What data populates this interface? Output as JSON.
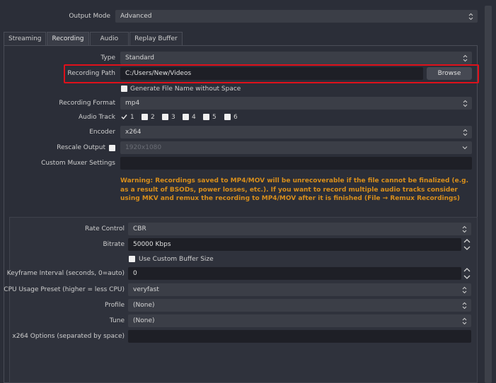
{
  "output_mode": {
    "label": "Output Mode",
    "value": "Advanced"
  },
  "tabs": [
    {
      "label": "Streaming",
      "active": false
    },
    {
      "label": "Recording",
      "active": true
    },
    {
      "label": "Audio",
      "active": false
    },
    {
      "label": "Replay Buffer",
      "active": false
    }
  ],
  "recording": {
    "type": {
      "label": "Type",
      "value": "Standard"
    },
    "path": {
      "label": "Recording Path",
      "value": "C:/Users/New/Videos",
      "browse_label": "Browse"
    },
    "generate_filename": {
      "label": "Generate File Name without Space",
      "checked": false
    },
    "format": {
      "label": "Recording Format",
      "value": "mp4"
    },
    "audio_track": {
      "label": "Audio Track",
      "tracks": [
        {
          "label": "1",
          "checked": true
        },
        {
          "label": "2",
          "checked": false
        },
        {
          "label": "3",
          "checked": false
        },
        {
          "label": "4",
          "checked": false
        },
        {
          "label": "5",
          "checked": false
        },
        {
          "label": "6",
          "checked": false
        }
      ]
    },
    "encoder": {
      "label": "Encoder",
      "value": "x264"
    },
    "rescale": {
      "label": "Rescale Output",
      "checked": false,
      "value": "1920x1080"
    },
    "custom_muxer": {
      "label": "Custom Muxer Settings",
      "value": ""
    },
    "warning": "Warning: Recordings saved to MP4/MOV will be unrecoverable if the file cannot be finalized (e.g. as a result of BSODs, power losses, etc.). If you want to record multiple audio tracks consider using MKV and remux the recording to MP4/MOV after it is finished (File → Remux Recordings)"
  },
  "encoder_settings": {
    "rate_control": {
      "label": "Rate Control",
      "value": "CBR"
    },
    "bitrate": {
      "label": "Bitrate",
      "value": "50000 Kbps"
    },
    "custom_buffer": {
      "label": "Use Custom Buffer Size",
      "checked": false
    },
    "keyframe": {
      "label": "Keyframe Interval (seconds, 0=auto)",
      "value": "0"
    },
    "cpu_preset": {
      "label": "CPU Usage Preset (higher = less CPU)",
      "value": "veryfast"
    },
    "profile": {
      "label": "Profile",
      "value": "(None)"
    },
    "tune": {
      "label": "Tune",
      "value": "(None)"
    },
    "x264_options": {
      "label": "x264 Options (separated by space)",
      "value": ""
    }
  },
  "colors": {
    "background": "#2b2e38",
    "warning": "#d98f1b",
    "highlight": "#e0101a"
  }
}
